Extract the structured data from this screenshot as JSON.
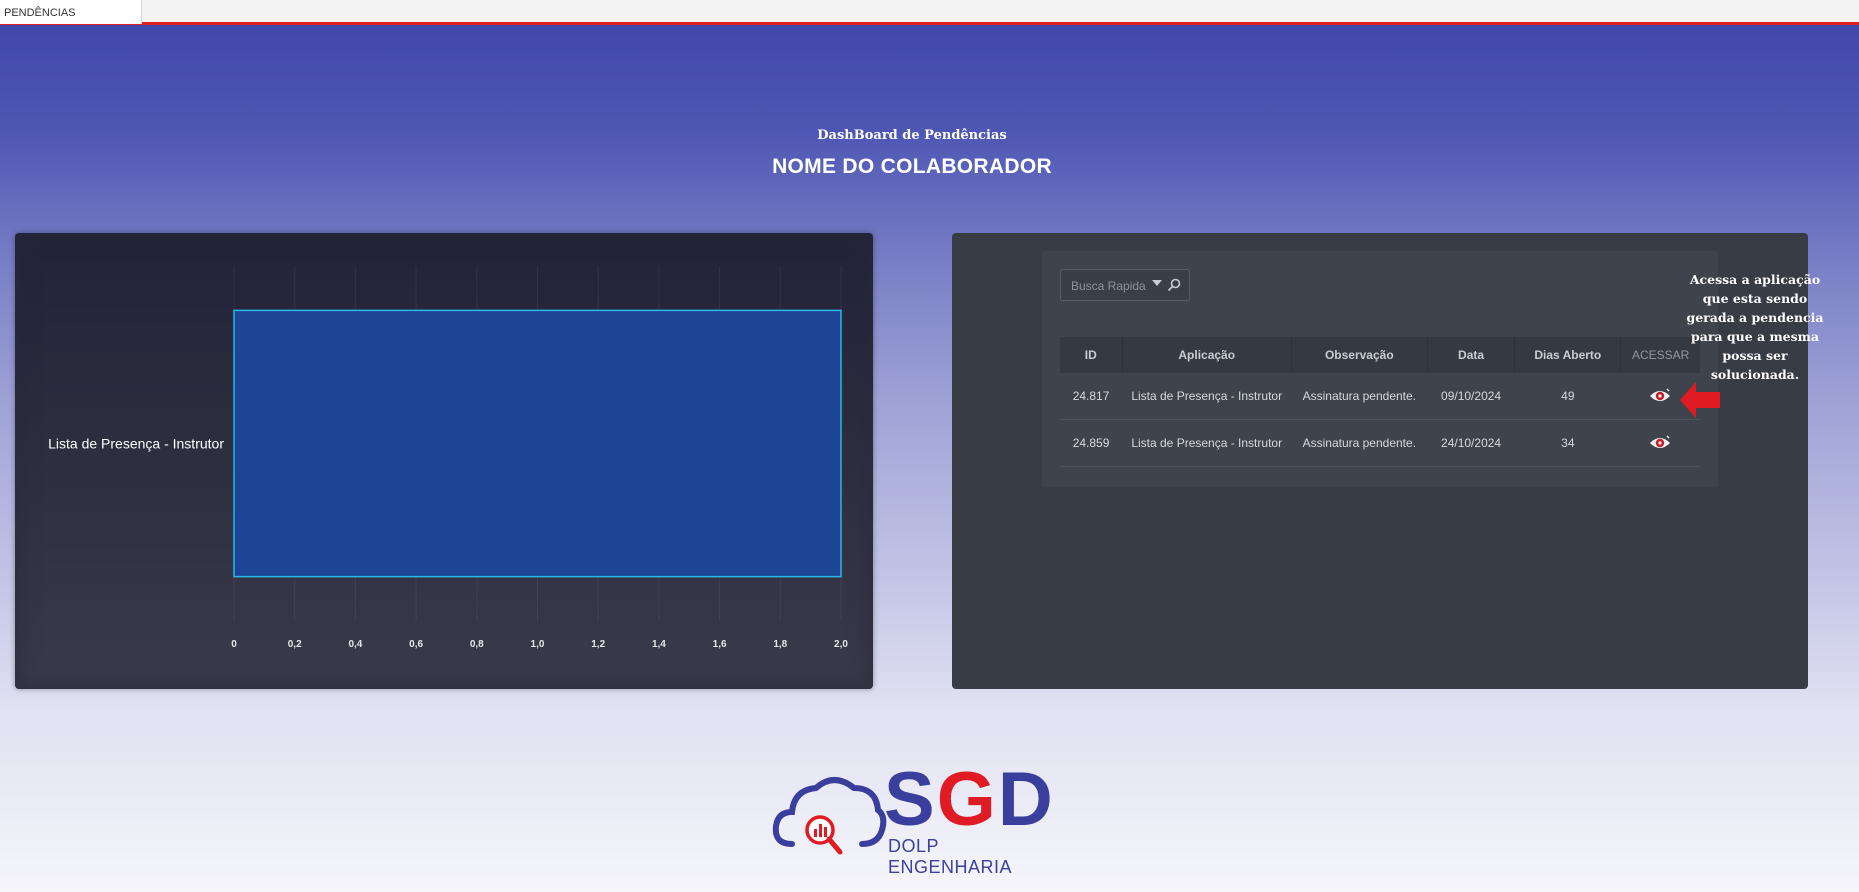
{
  "tab": {
    "label": "PENDÊNCIAS"
  },
  "header": {
    "subtitle": "DashBoard de Pendências",
    "title": "NOME DO COLABORADOR"
  },
  "chart_data": {
    "type": "bar",
    "orientation": "horizontal",
    "categories": [
      "Lista de Presença - Instrutor"
    ],
    "series": [
      {
        "values": [
          2
        ]
      }
    ],
    "xlim": [
      0,
      2
    ],
    "xticks": [
      "0",
      "0,2",
      "0,4",
      "0,6",
      "0,8",
      "1,0",
      "1,2",
      "1,4",
      "1,6",
      "1,8",
      "2,0"
    ],
    "title": "",
    "xlabel": "",
    "ylabel": "",
    "grid": true,
    "bar_color": "#1c4596",
    "bar_border": "#29b6e8"
  },
  "search": {
    "placeholder": "Busca Rapida",
    "icon": "search-icon"
  },
  "table": {
    "columns": [
      "ID",
      "Aplicação",
      "Observação",
      "Data",
      "Dias Aberto",
      "ACESSAR"
    ],
    "rows": [
      {
        "id": "24.817",
        "app": "Lista de Presença - Instrutor",
        "obs": "Assinatura pendente.",
        "date": "09/10/2024",
        "days": "49",
        "action": "eye-icon"
      },
      {
        "id": "24.859",
        "app": "Lista de Presença - Instrutor",
        "obs": "Assinatura pendente.",
        "date": "24/10/2024",
        "days": "34",
        "action": "eye-icon"
      }
    ]
  },
  "annotation": {
    "text": "Acessa a aplicação\nque esta  sendo\ngerada a pendencia\npara que a mesma\npossa ser\nsolucionada."
  },
  "logo": {
    "letter_1": "S",
    "letter_2": "G",
    "letter_3": "D",
    "subtitle": "DOLP ENGENHARIA",
    "colors": {
      "primary": "#3a3f9e",
      "accent": "#e01b24"
    }
  }
}
